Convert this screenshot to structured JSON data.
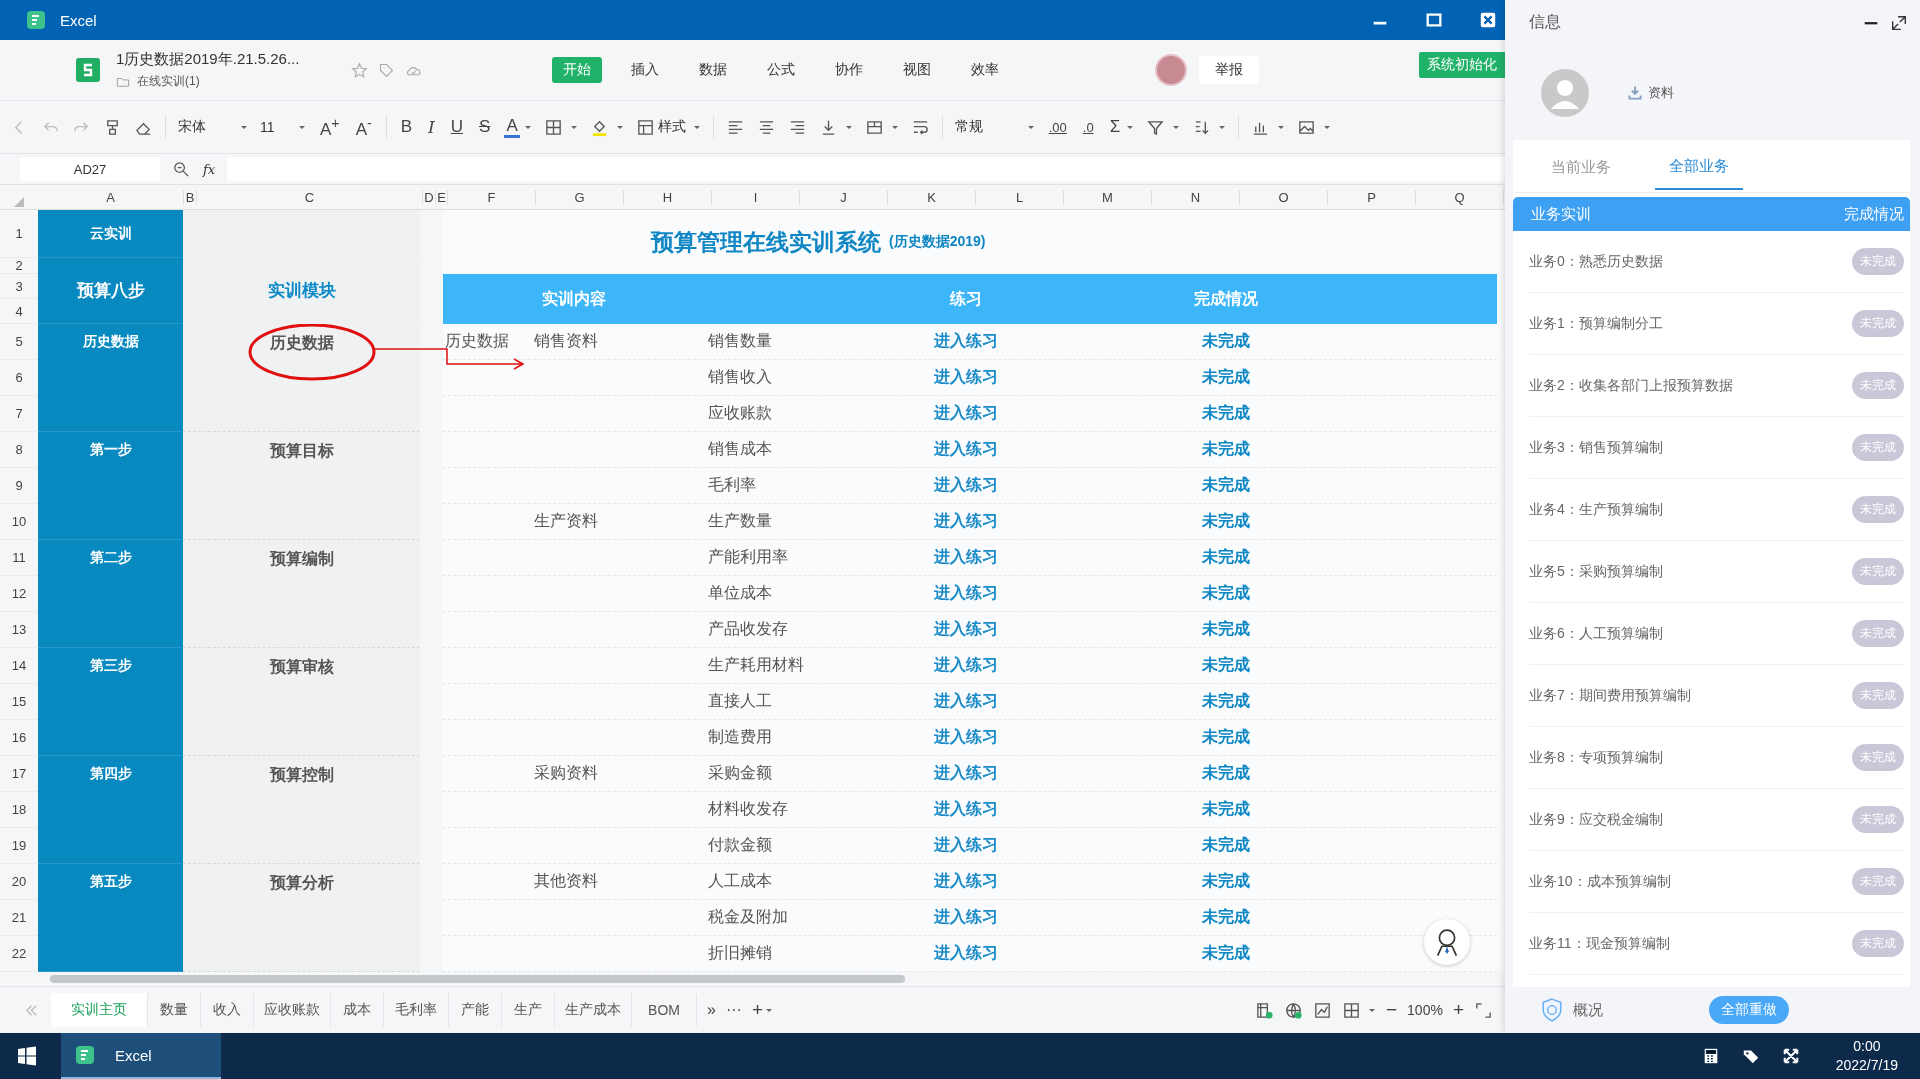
{
  "window": {
    "app": "Excel"
  },
  "document": {
    "title": "1历史数据2019年.21.5.26...",
    "folder": "在线实训(1)"
  },
  "menu": [
    {
      "label": "开始",
      "selected": true
    },
    {
      "label": "插入",
      "selected": false
    },
    {
      "label": "数据",
      "selected": false
    },
    {
      "label": "公式",
      "selected": false
    },
    {
      "label": "协作",
      "selected": false
    },
    {
      "label": "视图",
      "selected": false
    },
    {
      "label": "效率",
      "selected": false
    }
  ],
  "header_buttons": {
    "report": "举报",
    "init": "系统初始化"
  },
  "toolbar": {
    "font": "宋体",
    "size": "11",
    "grow": "A$^{+}$",
    "shrink": "A$^{-}$",
    "bold": "B",
    "italic": "I",
    "underline": "U",
    "strike": "S",
    "font_color": "A",
    "styles": "样式",
    "number_format": "常规",
    "add_decimal": ".00",
    "remove_decimal": ".0",
    "sum": "Σ"
  },
  "formula_bar": {
    "cell": "AD27",
    "fx": "fx"
  },
  "column_headers": [
    "A",
    "B",
    "C",
    "D",
    "E",
    "F",
    "G",
    "H",
    "I",
    "J",
    "K",
    "L",
    "M",
    "N",
    "O",
    "P",
    "Q"
  ],
  "row_headers": [
    "1",
    "2",
    "3",
    "4",
    "5",
    "6",
    "7",
    "8",
    "9",
    "10",
    "11",
    "12",
    "13",
    "14",
    "15",
    "16",
    "17",
    "18",
    "19",
    "20",
    "21",
    "22"
  ],
  "sheet": {
    "brand": "云实训",
    "steps_header": "预算八步",
    "modules_header": "实训模块",
    "title": "预算管理在线实训系统",
    "subtitle": "(历史数据2019)",
    "table_headers": [
      "实训内容",
      "练习",
      "完成情况"
    ],
    "groups": [
      {
        "step": "历史数据",
        "module": "历史数据",
        "circled": true
      },
      {
        "step": "第一步",
        "module": "预算目标",
        "circled": false
      },
      {
        "step": "第二步",
        "module": "预算编制",
        "circled": false
      },
      {
        "step": "第三步",
        "module": "预算审核",
        "circled": false
      },
      {
        "step": "第四步",
        "module": "预算控制",
        "circled": false
      },
      {
        "step": "第五步",
        "module": "预算分析",
        "circled": false
      }
    ],
    "rows": [
      {
        "section": "历史数据",
        "category": "销售资料",
        "item": "销售数量",
        "action": "进入练习",
        "status": "未完成"
      },
      {
        "item": "销售收入",
        "action": "进入练习",
        "status": "未完成"
      },
      {
        "item": "应收账款",
        "action": "进入练习",
        "status": "未完成"
      },
      {
        "item": "销售成本",
        "action": "进入练习",
        "status": "未完成"
      },
      {
        "item": "毛利率",
        "action": "进入练习",
        "status": "未完成"
      },
      {
        "category": "生产资料",
        "item": "生产数量",
        "action": "进入练习",
        "status": "未完成"
      },
      {
        "item": "产能利用率",
        "action": "进入练习",
        "status": "未完成"
      },
      {
        "item": "单位成本",
        "action": "进入练习",
        "status": "未完成"
      },
      {
        "item": "产品收发存",
        "action": "进入练习",
        "status": "未完成"
      },
      {
        "item": "生产耗用材料",
        "action": "进入练习",
        "status": "未完成"
      },
      {
        "item": "直接人工",
        "action": "进入练习",
        "status": "未完成"
      },
      {
        "item": "制造费用",
        "action": "进入练习",
        "status": "未完成"
      },
      {
        "category": "采购资料",
        "item": "采购金额",
        "action": "进入练习",
        "status": "未完成"
      },
      {
        "item": "材料收发存",
        "action": "进入练习",
        "status": "未完成"
      },
      {
        "item": "付款金额",
        "action": "进入练习",
        "status": "未完成"
      },
      {
        "category": "其他资料",
        "item": "人工成本",
        "action": "进入练习",
        "status": "未完成"
      },
      {
        "item": "税金及附加",
        "action": "进入练习",
        "status": "未完成"
      },
      {
        "item": "折旧摊销",
        "action": "进入练习",
        "status": "未完成"
      }
    ]
  },
  "sheet_tabs": [
    {
      "label": "实训主页",
      "selected": true
    },
    {
      "label": "数量",
      "selected": false
    },
    {
      "label": "收入",
      "selected": false
    },
    {
      "label": "应收账款",
      "selected": false
    },
    {
      "label": "成本",
      "selected": false
    },
    {
      "label": "毛利率",
      "selected": false
    },
    {
      "label": "产能",
      "selected": false
    },
    {
      "label": "生产",
      "selected": false
    },
    {
      "label": "生产成本",
      "selected": false
    },
    {
      "label": "BOM",
      "selected": false
    }
  ],
  "tab_controls": {
    "overflow": "»",
    "more": "···",
    "add": "+"
  },
  "zoom": {
    "minus": "−",
    "value": "100%",
    "plus": "+"
  },
  "panel": {
    "title": "信息",
    "download": "资料",
    "tabs": [
      {
        "label": "当前业务",
        "selected": false
      },
      {
        "label": "全部业务",
        "selected": true
      }
    ],
    "list_header": [
      "业务实训",
      "完成情况"
    ],
    "tasks": [
      {
        "name": "业务0：熟悉历史数据",
        "status": "未完成"
      },
      {
        "name": "业务1：预算编制分工",
        "status": "未完成"
      },
      {
        "name": "业务2：收集各部门上报预算数据",
        "status": "未完成"
      },
      {
        "name": "业务3：销售预算编制",
        "status": "未完成"
      },
      {
        "name": "业务4：生产预算编制",
        "status": "未完成"
      },
      {
        "name": "业务5：采购预算编制",
        "status": "未完成"
      },
      {
        "name": "业务6：人工预算编制",
        "status": "未完成"
      },
      {
        "name": "业务7：期间费用预算编制",
        "status": "未完成"
      },
      {
        "name": "业务8：专项预算编制",
        "status": "未完成"
      },
      {
        "name": "业务9：应交税金编制",
        "status": "未完成"
      },
      {
        "name": "业务10：成本预算编制",
        "status": "未完成"
      },
      {
        "name": "业务11：现金预算编制",
        "status": "未完成"
      }
    ],
    "overview": "概况",
    "redo": "全部重做"
  },
  "taskbar": {
    "app": "Excel",
    "time": "0:00",
    "date": "2022/7/19"
  }
}
